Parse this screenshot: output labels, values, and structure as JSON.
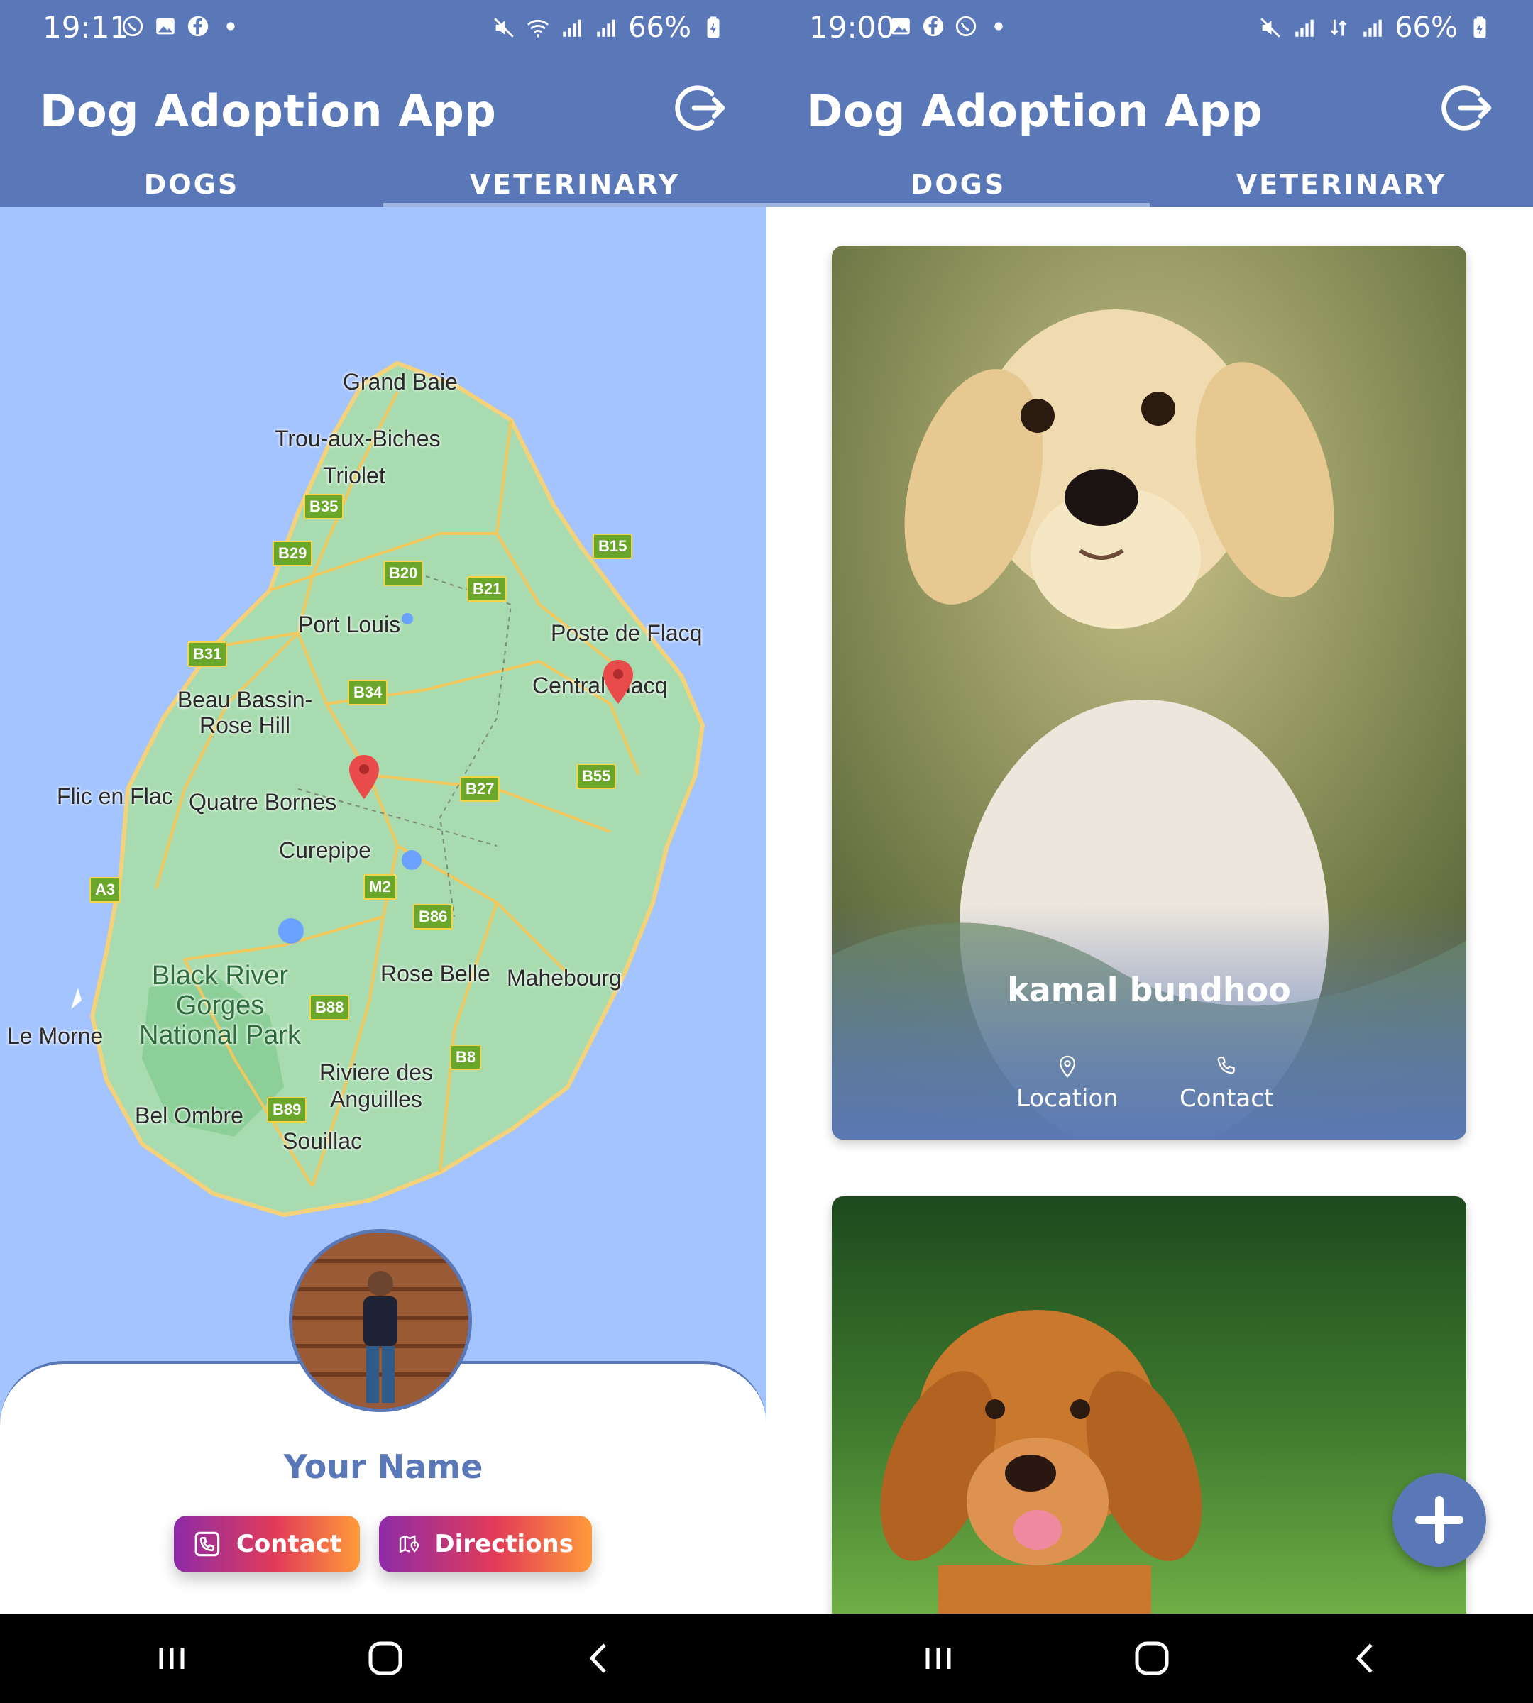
{
  "left_screen": {
    "status": {
      "time": "19:11",
      "battery": "66%"
    },
    "app_title": "Dog Adoption App",
    "tabs": [
      {
        "label": "DOGS",
        "active": false
      },
      {
        "label": "VETERINARY",
        "active": true
      }
    ],
    "map": {
      "labels": {
        "grand_baie": "Grand Baie",
        "trou_aux_biches": "Trou-aux-Biches",
        "triolet": "Triolet",
        "port_louis": "Port Louis",
        "poste_de_flacq": "Poste de Flacq",
        "central_flacq": "Central Flacq",
        "beau_bassin": "Beau Bassin-Rose Hill",
        "flic_en_flac": "Flic en Flac",
        "quatre_bornes": "Quatre Bornes",
        "curepipe": "Curepipe",
        "black_river": "Black River Gorges National Park",
        "rose_belle": "Rose Belle",
        "mahebourg": "Mahebourg",
        "le_morne": "Le Morne",
        "riviere": "Riviere des Anguilles",
        "bel_ombre": "Bel Ombre",
        "souillac": "Souillac"
      },
      "roads": {
        "b35": "B35",
        "b29": "B29",
        "b20": "B20",
        "b21": "B21",
        "b15": "B15",
        "b31": "B31",
        "b34": "B34",
        "b55": "B55",
        "b27": "B27",
        "a3": "A3",
        "m2": "M2",
        "b86": "B86",
        "b88": "B88",
        "b8": "B8",
        "b89": "B89"
      }
    },
    "profile": {
      "name": "Your Name",
      "contact_label": "Contact",
      "directions_label": "Directions"
    }
  },
  "right_screen": {
    "status": {
      "time": "19:00",
      "battery": "66%"
    },
    "app_title": "Dog Adoption App",
    "tabs": [
      {
        "label": "DOGS",
        "active": true
      },
      {
        "label": "VETERINARY",
        "active": false
      }
    ],
    "cards": [
      {
        "name": "kamal bundhoo",
        "location_label": "Location",
        "contact_label": "Contact"
      }
    ]
  },
  "colors": {
    "primary": "#5a78b8",
    "map_water": "#a4c4ff",
    "map_land": "#a8dcb0",
    "pin": "#e94b4b",
    "gradient_start": "#8e2ba8",
    "gradient_end": "#ff9a3a"
  }
}
